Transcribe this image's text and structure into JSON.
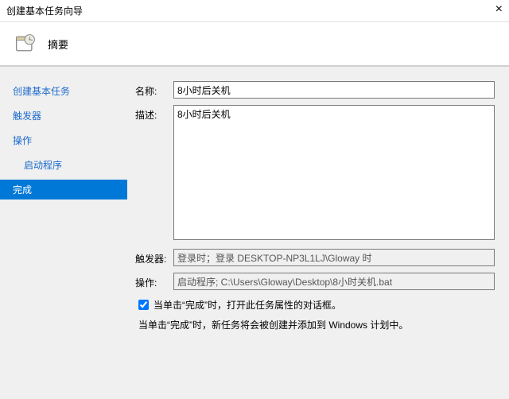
{
  "window": {
    "title": "创建基本任务向导"
  },
  "header": {
    "title": "摘要"
  },
  "sidebar": {
    "items": [
      {
        "label": "创建基本任务",
        "indent": false,
        "active": false
      },
      {
        "label": "触发器",
        "indent": false,
        "active": false
      },
      {
        "label": "操作",
        "indent": false,
        "active": false
      },
      {
        "label": "启动程序",
        "indent": true,
        "active": false
      },
      {
        "label": "完成",
        "indent": false,
        "active": true
      }
    ]
  },
  "form": {
    "name_label": "名称:",
    "name_value": "8小时后关机",
    "desc_label": "描述:",
    "desc_value": "8小时后关机",
    "trigger_label": "触发器:",
    "trigger_value": "登录时；登录 DESKTOP-NP3L1LJ\\Gloway 时",
    "action_label": "操作:",
    "action_value": "启动程序; C:\\Users\\Gloway\\Desktop\\8小时关机.bat",
    "checkbox_label": "当单击“完成”时，打开此任务属性的对话框。",
    "info_text": "当单击“完成”时，新任务将会被创建并添加到 Windows 计划中。"
  }
}
